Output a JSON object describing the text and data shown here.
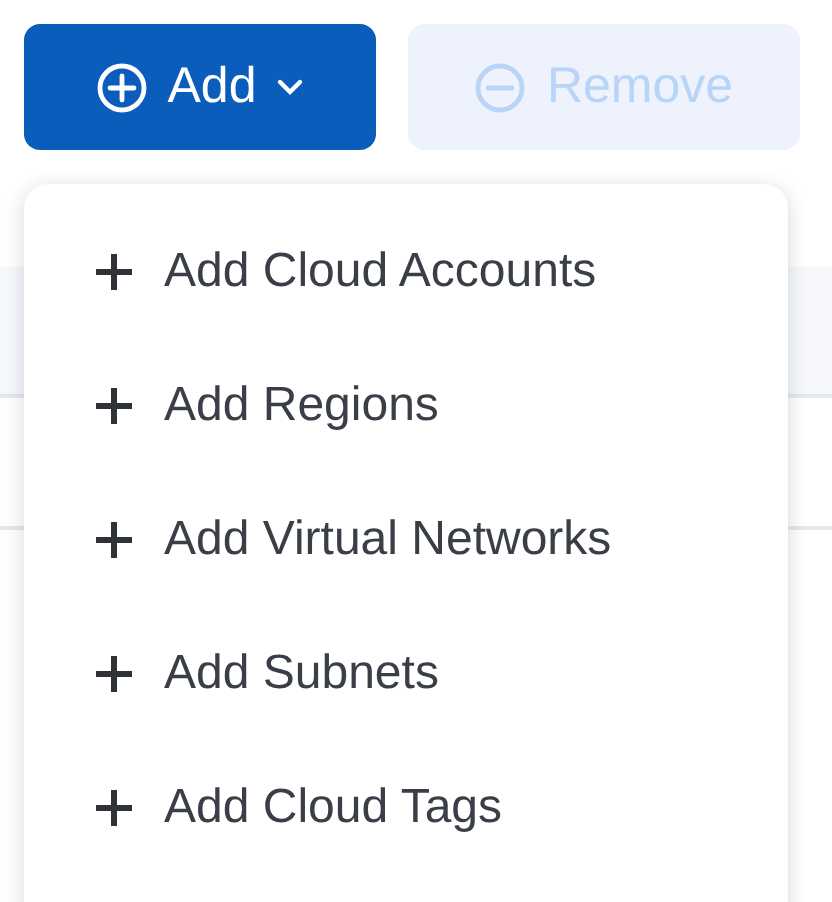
{
  "toolbar": {
    "buttons": [
      {
        "kind": "add",
        "label": "Add",
        "disabled": false,
        "has_menu": true
      },
      {
        "kind": "remove",
        "label": "Remove",
        "disabled": true,
        "has_menu": false
      }
    ]
  },
  "menu": {
    "items": [
      {
        "label": "Add Cloud Accounts"
      },
      {
        "label": "Add Regions"
      },
      {
        "label": "Add Virtual Networks"
      },
      {
        "label": "Add Subnets"
      },
      {
        "label": "Add Cloud Tags"
      }
    ]
  }
}
